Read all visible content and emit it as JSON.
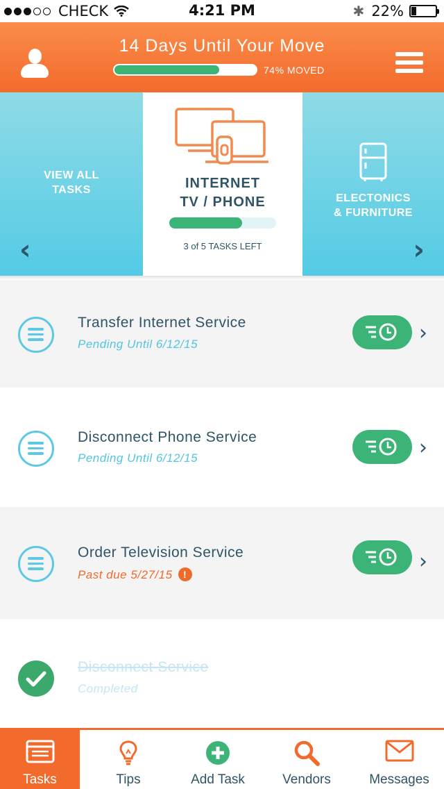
{
  "status_bar": {
    "carrier": "CHECK",
    "time": "4:21 PM",
    "battery": "22%",
    "signal_dots_filled": 3,
    "signal_dots_total": 5,
    "battery_level": 0.22
  },
  "header": {
    "title": "14 Days Until Your Move",
    "progress_label": "74% MOVED",
    "progress_value": 0.74
  },
  "carousel": {
    "left_label": "VIEW ALL\nTASKS",
    "center_title": "INTERNET\nTV / PHONE",
    "center_progress_value": 0.68,
    "center_tasks_left": "3 of 5 TASKS LEFT",
    "right_label": "ELECTONICS\n& FURNITURE",
    "center_icon": "devices-icon",
    "right_icon": "refrigerator-icon"
  },
  "tasks": [
    {
      "title": "Transfer Internet Service",
      "subtitle": "Pending Until 6/12/15",
      "status": "pending"
    },
    {
      "title": "Disconnect Phone Service",
      "subtitle": "Pending Until 6/12/15",
      "status": "pending"
    },
    {
      "title": "Order Television Service",
      "subtitle": "Past due 5/27/15",
      "status": "past-due"
    },
    {
      "title": "Disconnect Service",
      "subtitle": "Completed",
      "status": "completed"
    }
  ],
  "tabbar": {
    "tasks": "Tasks",
    "tips": "Tips",
    "add_task": "Add Task",
    "vendors": "Vendors",
    "messages": "Messages",
    "active": "tasks"
  },
  "colors": {
    "brand_orange": "#f26b2c",
    "accent_blue": "#5cc8e4",
    "success_green": "#3db477",
    "text_dark": "#2f5466"
  }
}
